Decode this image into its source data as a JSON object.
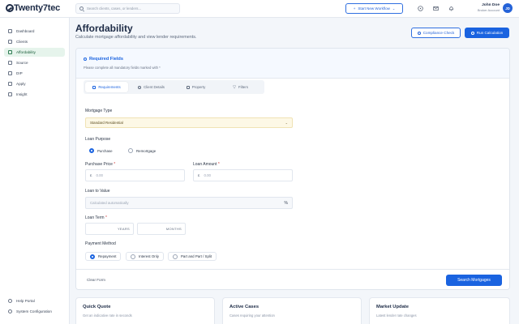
{
  "app": {
    "logo_text": "Twenty7tec"
  },
  "search": {
    "placeholder": "Search clients, cases, or lenders..."
  },
  "header": {
    "new_workflow_label": "Start New Workflow"
  },
  "user": {
    "name": "John Doe",
    "role": "Broker Account",
    "initials": "JD"
  },
  "sidebar": {
    "items": [
      {
        "label": "Dashboard",
        "icon": "dashboard-icon",
        "active": false
      },
      {
        "label": "Clients",
        "icon": "clients-icon",
        "active": false
      },
      {
        "label": "Affordability",
        "icon": "affordability-icon",
        "active": true
      },
      {
        "label": "Source",
        "icon": "source-icon",
        "active": false
      },
      {
        "label": "DIP",
        "icon": "dip-icon",
        "active": false
      },
      {
        "label": "Apply",
        "icon": "apply-icon",
        "active": false
      },
      {
        "label": "Insight",
        "icon": "insight-icon",
        "active": false
      }
    ],
    "bottom_items": [
      {
        "label": "Help Portal",
        "icon": "help-icon"
      },
      {
        "label": "System Configuration",
        "icon": "settings-icon"
      }
    ]
  },
  "page": {
    "title": "Affordability",
    "subtitle": "Calculate mortgage affordability and view lender requirements.",
    "compliance_label": "Compliance Check",
    "run_label": "Run Calculation"
  },
  "form": {
    "title": "Required Fields",
    "note": "Please complete all mandatory fields marked with *",
    "tabs": [
      {
        "label": "Requirements",
        "active": true
      },
      {
        "label": "Client Details",
        "active": false
      },
      {
        "label": "Property",
        "active": false
      },
      {
        "label": "Filters",
        "active": false
      }
    ],
    "mortgage_type_label": "Mortgage Type",
    "mortgage_type_value": "Standard Residential",
    "loan_purpose_label": "Loan Purpose",
    "loan_purpose_options": [
      "Purchase",
      "Remortgage"
    ],
    "purchase_price_label": "Purchase Price",
    "loan_amount_label": "Loan Amount",
    "currency_symbol": "£",
    "amount_placeholder": "0.00",
    "ltv_label": "Loan to Value",
    "ltv_placeholder": "Calculated automatically",
    "ltv_suffix": "%",
    "loan_term_label": "Loan Term",
    "years_label": "YEARS",
    "months_label": "MONTHS",
    "payment_method_label": "Payment Method",
    "payment_options": [
      "Repayment",
      "Interest Only",
      "Part and Part / Split"
    ],
    "required_mark": "*",
    "clear_label": "Clear Form",
    "submit_label": "Search Mortgages"
  },
  "cards": [
    {
      "title": "Quick Quote",
      "subtitle": "Get an indicative rate in seconds"
    },
    {
      "title": "Active Cases",
      "subtitle": "Cases requiring your attention"
    },
    {
      "title": "Market Update",
      "subtitle": "Latest lender rate changes"
    }
  ],
  "colors": {
    "primary": "#1a63e0",
    "active_nav_bg": "#e6f4ec",
    "highlight_field": "#fdf8e6"
  }
}
